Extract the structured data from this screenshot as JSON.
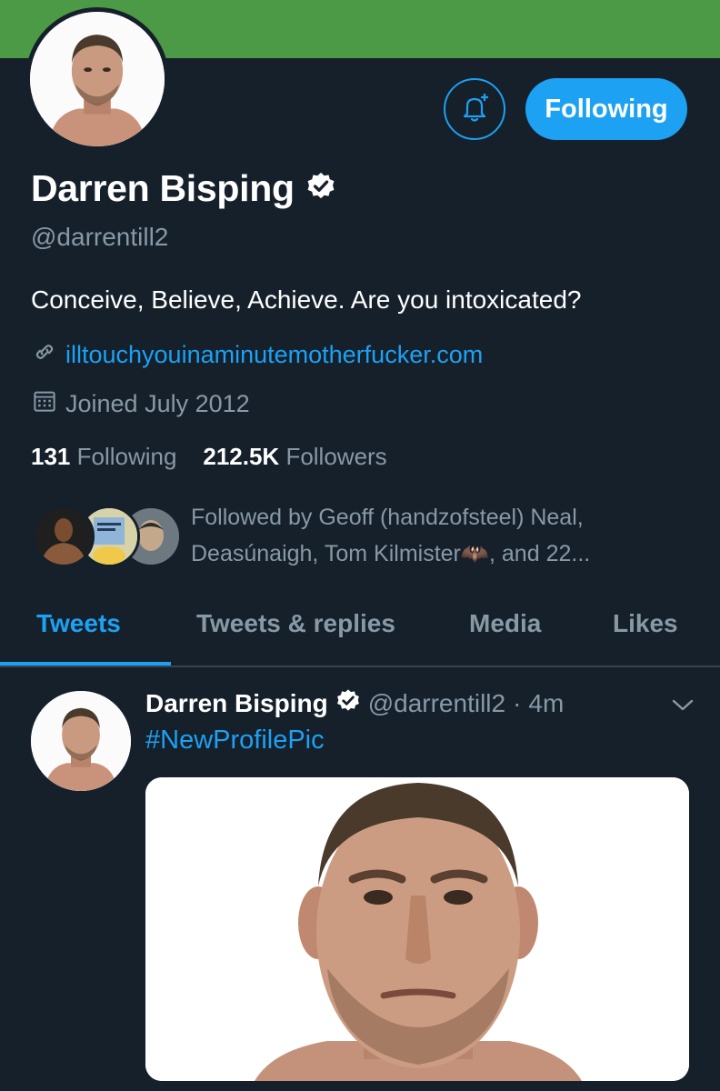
{
  "colors": {
    "accent": "#1da1f2",
    "background": "#15202b",
    "banner": "#4c9a45",
    "muted": "#8899a6"
  },
  "profile": {
    "name": "Darren Bisping",
    "handle": "@darrentill2",
    "bio": "Conceive, Believe, Achieve. Are you intoxicated?",
    "website": "illtouchyouinaminutemotherfucker.com",
    "joined": "Joined July 2012",
    "following_count": "131",
    "following_label": "Following",
    "followers_count": "212.5K",
    "followers_label": "Followers",
    "follow_button_label": "Following",
    "followed_by_line1": "Followed by Geoff (handzofsteel) Neal,",
    "followed_by_line2": "Deasúnaigh, Tom Kilmister🦇, and 22..."
  },
  "tabs": [
    {
      "label": "Tweets",
      "active": true
    },
    {
      "label": "Tweets & replies",
      "active": false
    },
    {
      "label": "Media",
      "active": false
    },
    {
      "label": "Likes",
      "active": false
    }
  ],
  "tweet": {
    "name": "Darren Bisping",
    "handle": "@darrentill2",
    "separator": "·",
    "time": "4m",
    "text": "#NewProfilePic"
  },
  "icons": [
    "verified-icon",
    "bell-plus-icon",
    "link-icon",
    "calendar-icon",
    "chevron-down-icon"
  ]
}
